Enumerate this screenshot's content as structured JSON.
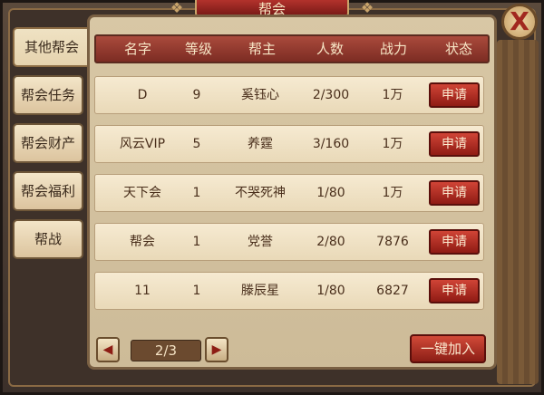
{
  "title": "帮会",
  "close_label": "X",
  "sidebar": {
    "tabs": [
      {
        "label": "其他帮会",
        "active": true
      },
      {
        "label": "帮会任务",
        "active": false
      },
      {
        "label": "帮会财产",
        "active": false
      },
      {
        "label": "帮会福利",
        "active": false
      },
      {
        "label": "帮战",
        "active": false
      }
    ]
  },
  "table": {
    "headers": [
      "名字",
      "等级",
      "帮主",
      "人数",
      "战力",
      "状态"
    ],
    "rows": [
      {
        "name": "D",
        "level": "9",
        "leader": "奚钰心",
        "members": "2/300",
        "power": "1万",
        "action": "申请"
      },
      {
        "name": "风云VIP",
        "level": "5",
        "leader": "养霆",
        "members": "3/160",
        "power": "1万",
        "action": "申请"
      },
      {
        "name": "天下会",
        "level": "1",
        "leader": "不哭死神",
        "members": "1/80",
        "power": "1万",
        "action": "申请"
      },
      {
        "name": "帮会",
        "level": "1",
        "leader": "党誉",
        "members": "2/80",
        "power": "7876",
        "action": "申请"
      },
      {
        "name": "11",
        "level": "1",
        "leader": "滕辰星",
        "members": "1/80",
        "power": "6827",
        "action": "申请"
      }
    ]
  },
  "pager": {
    "label": "2/3",
    "prev_icon": "left-arrow-icon",
    "next_icon": "right-arrow-icon"
  },
  "join_all_label": "一键加入",
  "colors": {
    "accent_red": "#8f1b14",
    "parchment": "#e9d9b8",
    "header_red": "#7c2c23"
  }
}
